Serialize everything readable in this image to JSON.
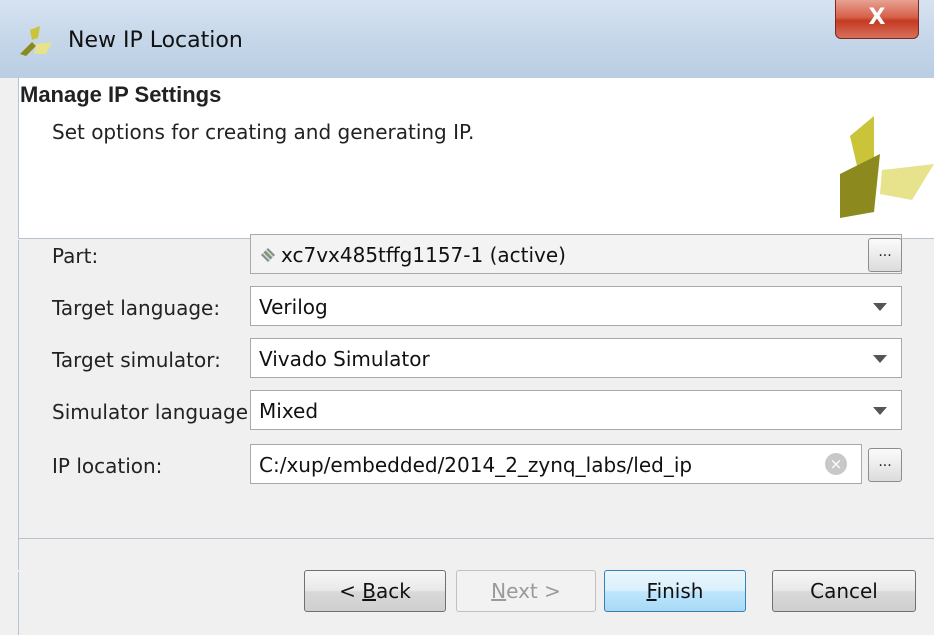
{
  "window": {
    "title": "New IP Location",
    "close_label": "X"
  },
  "header": {
    "title": "Manage IP Settings",
    "subtitle": "Set options for creating and generating IP."
  },
  "form": {
    "part": {
      "label": "Part:",
      "value": "xc7vx485tffg1157-1 (active)",
      "browse_label": "..."
    },
    "target_language": {
      "label": "Target language:",
      "value": "Verilog"
    },
    "target_simulator": {
      "label": "Target simulator:",
      "value": "Vivado Simulator"
    },
    "simulator_language": {
      "label": "Simulator language:",
      "value": "Mixed"
    },
    "ip_location": {
      "label": "IP location:",
      "value": "C:/xup/embedded/2014_2_zynq_labs/led_ip",
      "browse_label": "...",
      "clear_icon": "×"
    }
  },
  "buttons": {
    "back": {
      "prefix": "< ",
      "mnemonic": "B",
      "rest": "ack"
    },
    "next": {
      "mnemonic": "N",
      "rest": "ext >"
    },
    "finish": {
      "mnemonic": "F",
      "rest": "inish"
    },
    "cancel": "Cancel"
  },
  "icons": {
    "title_logo": "vivado-logo-icon",
    "header_logo": "vivado-logo-icon",
    "part_icon": "chip-icon",
    "dropdown_icon": "chevron-down-icon",
    "clear_icon": "clear-icon"
  },
  "colors": {
    "logo_dark": "#8c8a1e",
    "logo_mid": "#c9c43a",
    "logo_light": "#e6e38c",
    "close_red": "#c43a22",
    "default_button_border": "#3c7fb1"
  }
}
